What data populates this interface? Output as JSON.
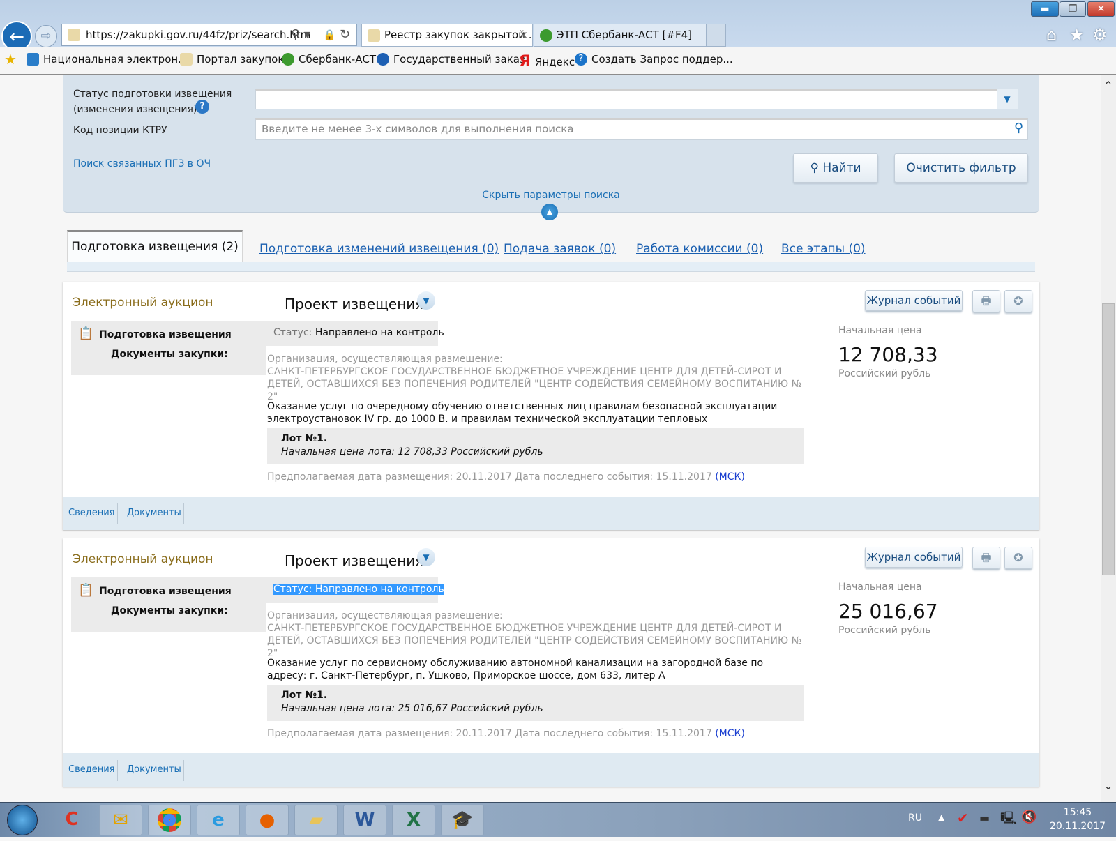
{
  "browser": {
    "address": "https://zakupki.gov.ru/44fz/priz/search.htm",
    "tabs": [
      {
        "label": "Реестр закупок закрытой ...",
        "close": "×"
      },
      {
        "label": "ЭТП Сбербанк-АСТ [#F4]"
      }
    ],
    "favorites": [
      "Национальная электрон...",
      "Портал закупок",
      "Сбербанк-АСТ",
      "Государственный заказ",
      "Яндекс",
      "Создать Запрос поддер..."
    ]
  },
  "search": {
    "status_label_1": "Статус подготовки извещения",
    "status_label_2": "(изменения извещения)",
    "status_value": "",
    "ktru_label": "Код позиции КТРУ",
    "ktru_placeholder": "Введите не менее 3-х символов для выполнения поиска",
    "related_link": "Поиск связанных ПГЗ в ОЧ",
    "find_button": "Найти",
    "clear_button": "Очистить фильтр",
    "hide_link": "Скрыть параметры поиска"
  },
  "tabs": [
    {
      "label": "Подготовка извещения (2)",
      "active": true
    },
    {
      "label": "Подготовка изменений извещения (0)"
    },
    {
      "label": "Подача заявок (0)"
    },
    {
      "label": "Работа комиссии (0)"
    },
    {
      "label": "Все этапы (0)"
    }
  ],
  "cards": [
    {
      "type": "Электронный аукцион",
      "project": "Проект извещения",
      "stage": "Подготовка извещения",
      "docs": "Документы закупки:",
      "status_label": "Статус:",
      "status": "Направлено на контроль",
      "status_selected": false,
      "org_label": "Организация, осуществляющая размещение:",
      "org": "САНКТ-ПЕТЕРБУРГСКОЕ ГОСУДАРСТВЕННОЕ БЮДЖЕТНОЕ УЧРЕЖДЕНИЕ ЦЕНТР ДЛЯ ДЕТЕЙ-СИРОТ И ДЕТЕЙ, ОСТАВШИХСЯ БЕЗ ПОПЕЧЕНИЯ РОДИТЕЛЕЙ \"ЦЕНТР СОДЕЙСТВИЯ СЕМЕЙНОМУ ВОСПИТАНИЮ № 2\"",
      "desc": "Оказание услуг по очередному обучению ответственных лиц правилам безопасной эксплуатации электроустановок IV гр. до 1000 В. и правилам технической эксплуатации тепловых энергоустановок",
      "lot": "Лот №1.",
      "lot_price": "Начальная цена лота: 12 708,33 Российский рубль",
      "dates": "Предполагаемая дата размещения: 20.11.2017  Дата последнего события: 15.11.2017",
      "tz": "(МСК)",
      "price_label": "Начальная цена",
      "price": "12 708,33",
      "currency": "Российский рубль",
      "journal": "Журнал событий",
      "links": [
        "Сведения",
        "Документы"
      ]
    },
    {
      "type": "Электронный аукцион",
      "project": "Проект извещения",
      "stage": "Подготовка извещения",
      "docs": "Документы закупки:",
      "status_label": "Статус:",
      "status": "Направлено на контроль",
      "status_selected": true,
      "org_label": "Организация, осуществляющая размещение:",
      "org": "САНКТ-ПЕТЕРБУРГСКОЕ ГОСУДАРСТВЕННОЕ БЮДЖЕТНОЕ УЧРЕЖДЕНИЕ ЦЕНТР ДЛЯ ДЕТЕЙ-СИРОТ И ДЕТЕЙ, ОСТАВШИХСЯ БЕЗ ПОПЕЧЕНИЯ РОДИТЕЛЕЙ \"ЦЕНТР СОДЕЙСТВИЯ СЕМЕЙНОМУ ВОСПИТАНИЮ № 2\"",
      "desc": "Оказание услуг по сервисному обслуживанию автономной канализации на загородной базе по адресу: г. Санкт-Петербург, п. Ушково, Приморское шоссе, дом 633, литер А",
      "lot": "Лот №1.",
      "lot_price": "Начальная цена лота: 25 016,67 Российский рубль",
      "dates": "Предполагаемая дата размещения: 20.11.2017  Дата последнего события: 15.11.2017",
      "tz": "(МСК)",
      "price_label": "Начальная цена",
      "price": "25 016,67",
      "currency": "Российский рубль",
      "journal": "Журнал событий",
      "links": [
        "Сведения",
        "Документы"
      ]
    }
  ],
  "taskbar": {
    "lang": "RU",
    "time": "15:45",
    "date": "20.11.2017"
  },
  "colors": {
    "accent": "#1a6fb5",
    "panel": "#d7e2ec",
    "selection": "#3399ff"
  }
}
